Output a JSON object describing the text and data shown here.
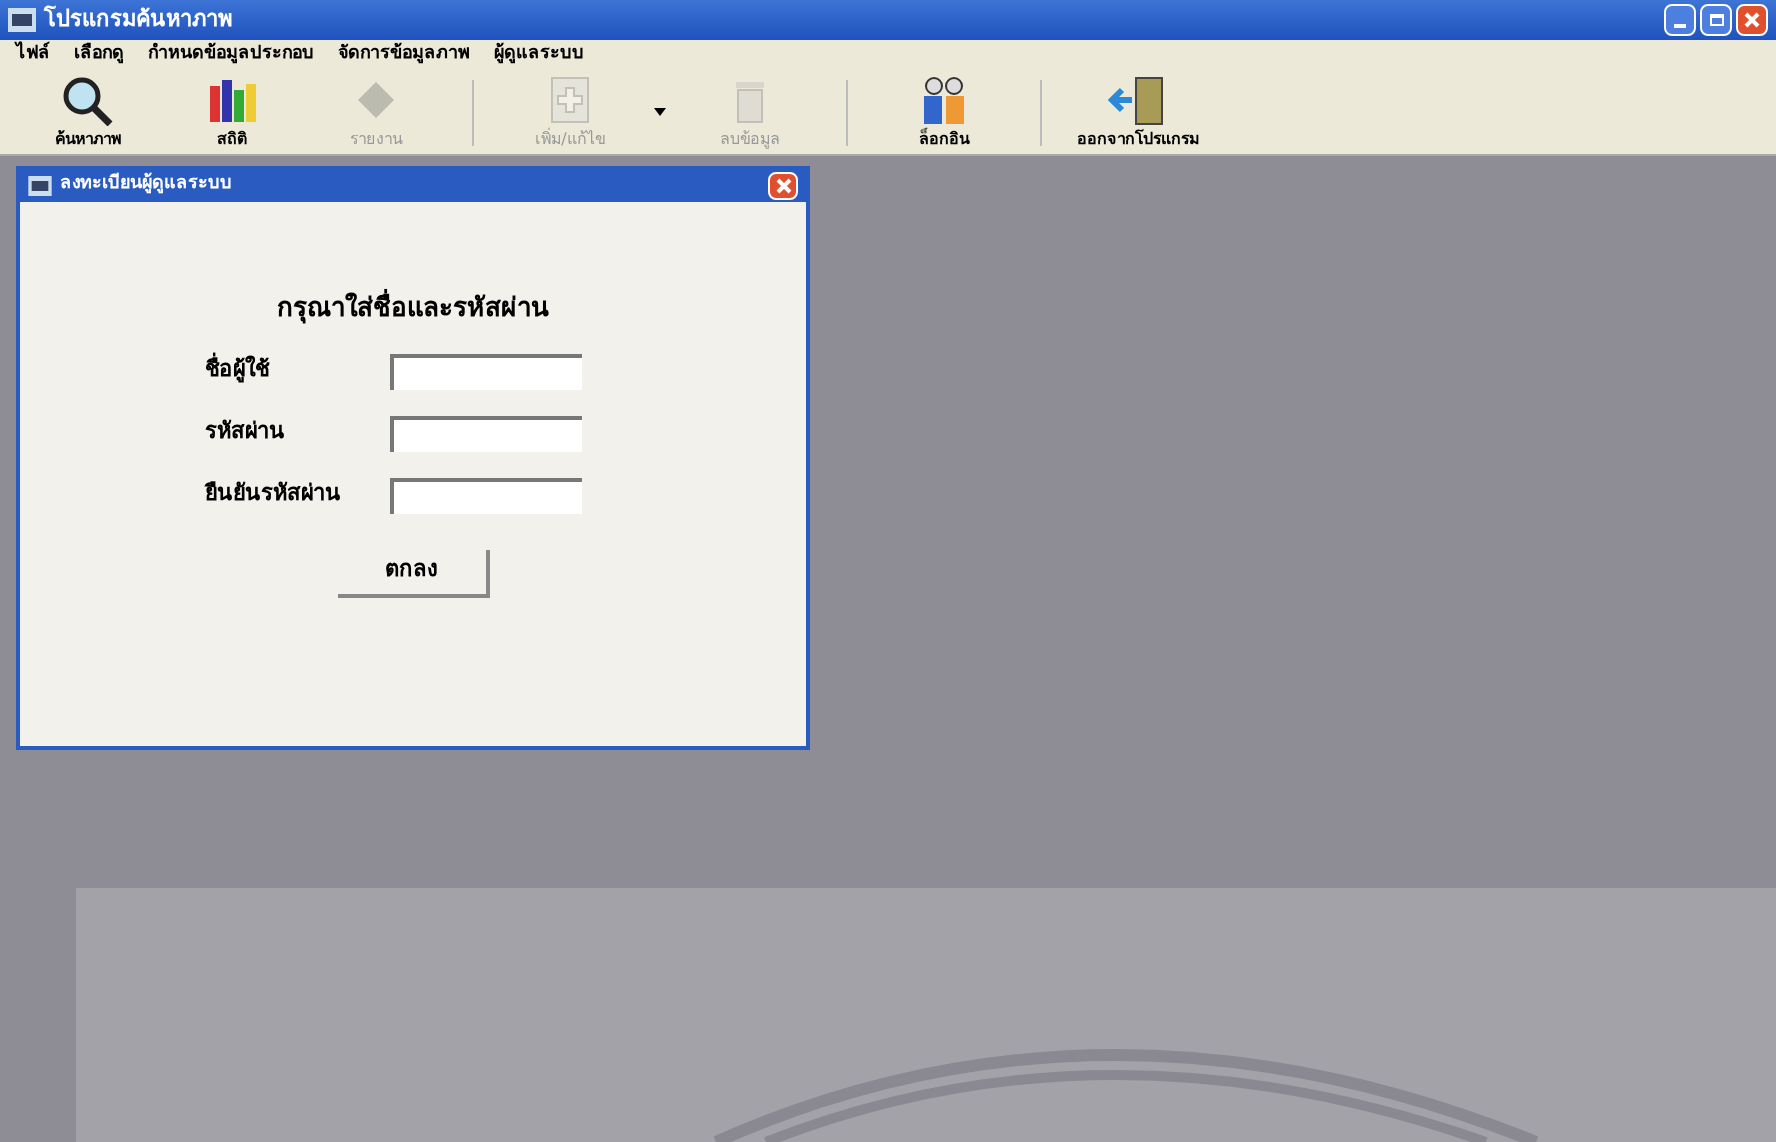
{
  "window": {
    "title": "โปรแกรมค้นหาภาพ"
  },
  "menu": [
    "ไฟล์",
    "เลือกดู",
    "กำหนดข้อมูลประกอบ",
    "จัดการข้อมูลภาพ",
    "ผู้ดูแลระบบ"
  ],
  "toolbar": [
    {
      "kind": "button",
      "label": "ค้นหาภาพ",
      "disabled": false
    },
    {
      "kind": "button",
      "label": "สถิติ",
      "disabled": false
    },
    {
      "kind": "button",
      "label": "รายงาน",
      "disabled": true
    },
    {
      "kind": "separator"
    },
    {
      "kind": "button",
      "label": "เพิ่ม/แก้ไข",
      "disabled": true
    },
    {
      "kind": "dropdown"
    },
    {
      "kind": "button",
      "label": "ลบข้อมูล",
      "disabled": true
    },
    {
      "kind": "separator"
    },
    {
      "kind": "button",
      "label": "ล็อกอิน",
      "disabled": false
    },
    {
      "kind": "separator"
    },
    {
      "kind": "button",
      "label": "ออกจากโปรแกรม",
      "disabled": false
    }
  ],
  "dialog": {
    "title": "ลงทะเบียนผู้ดูแลระบบ",
    "heading": "กรุณาใส่ชื่อและรหัสผ่าน",
    "fields": [
      {
        "label": "ชื่อผู้ใช้"
      },
      {
        "label": "รหัสผ่าน"
      },
      {
        "label": "ยืนยันรหัสผ่าน"
      }
    ],
    "button": "ตกลง"
  }
}
